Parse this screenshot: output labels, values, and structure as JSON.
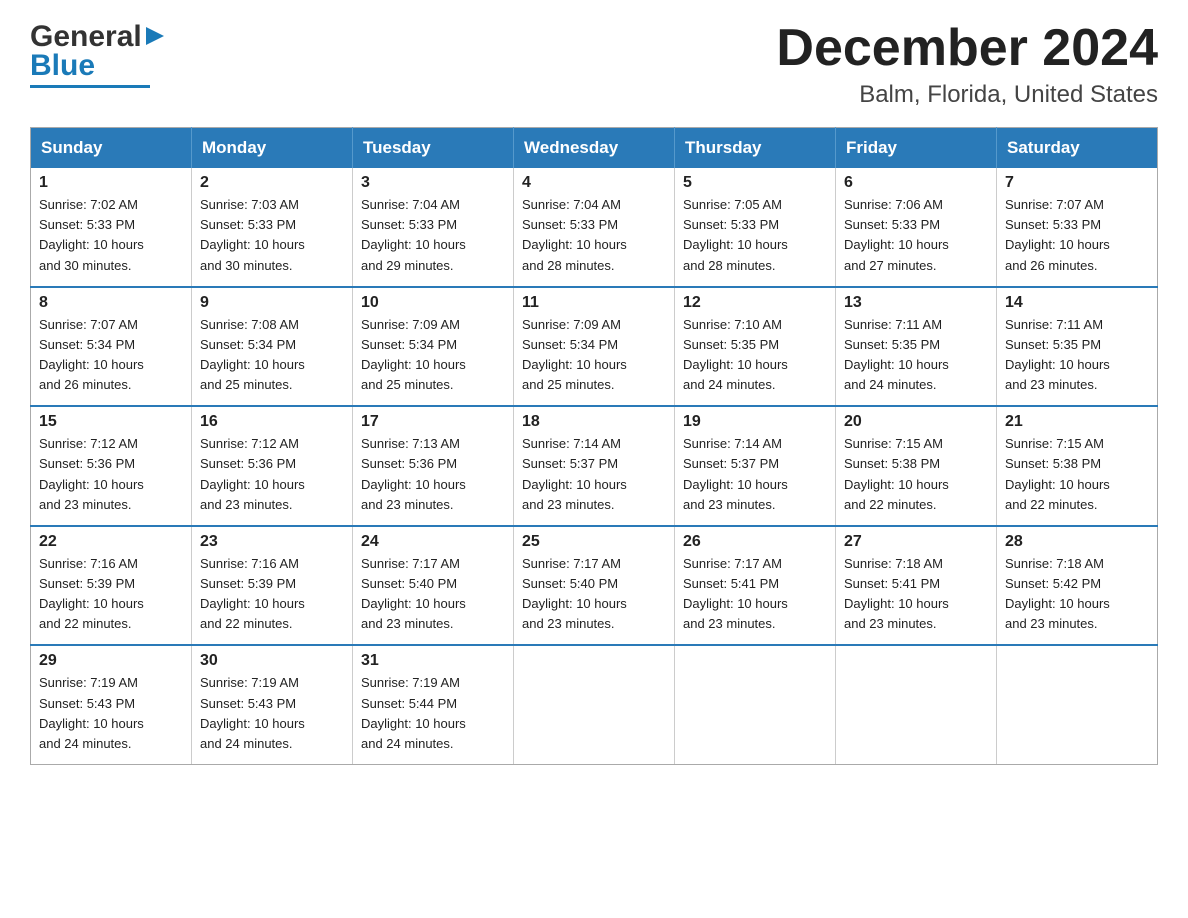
{
  "logo": {
    "text_general": "General",
    "text_blue": "Blue",
    "triangle": "▶"
  },
  "title": {
    "month": "December 2024",
    "location": "Balm, Florida, United States"
  },
  "headers": [
    "Sunday",
    "Monday",
    "Tuesday",
    "Wednesday",
    "Thursday",
    "Friday",
    "Saturday"
  ],
  "weeks": [
    [
      {
        "day": "1",
        "sunrise": "7:02 AM",
        "sunset": "5:33 PM",
        "daylight": "10 hours and 30 minutes."
      },
      {
        "day": "2",
        "sunrise": "7:03 AM",
        "sunset": "5:33 PM",
        "daylight": "10 hours and 30 minutes."
      },
      {
        "day": "3",
        "sunrise": "7:04 AM",
        "sunset": "5:33 PM",
        "daylight": "10 hours and 29 minutes."
      },
      {
        "day": "4",
        "sunrise": "7:04 AM",
        "sunset": "5:33 PM",
        "daylight": "10 hours and 28 minutes."
      },
      {
        "day": "5",
        "sunrise": "7:05 AM",
        "sunset": "5:33 PM",
        "daylight": "10 hours and 28 minutes."
      },
      {
        "day": "6",
        "sunrise": "7:06 AM",
        "sunset": "5:33 PM",
        "daylight": "10 hours and 27 minutes."
      },
      {
        "day": "7",
        "sunrise": "7:07 AM",
        "sunset": "5:33 PM",
        "daylight": "10 hours and 26 minutes."
      }
    ],
    [
      {
        "day": "8",
        "sunrise": "7:07 AM",
        "sunset": "5:34 PM",
        "daylight": "10 hours and 26 minutes."
      },
      {
        "day": "9",
        "sunrise": "7:08 AM",
        "sunset": "5:34 PM",
        "daylight": "10 hours and 25 minutes."
      },
      {
        "day": "10",
        "sunrise": "7:09 AM",
        "sunset": "5:34 PM",
        "daylight": "10 hours and 25 minutes."
      },
      {
        "day": "11",
        "sunrise": "7:09 AM",
        "sunset": "5:34 PM",
        "daylight": "10 hours and 25 minutes."
      },
      {
        "day": "12",
        "sunrise": "7:10 AM",
        "sunset": "5:35 PM",
        "daylight": "10 hours and 24 minutes."
      },
      {
        "day": "13",
        "sunrise": "7:11 AM",
        "sunset": "5:35 PM",
        "daylight": "10 hours and 24 minutes."
      },
      {
        "day": "14",
        "sunrise": "7:11 AM",
        "sunset": "5:35 PM",
        "daylight": "10 hours and 23 minutes."
      }
    ],
    [
      {
        "day": "15",
        "sunrise": "7:12 AM",
        "sunset": "5:36 PM",
        "daylight": "10 hours and 23 minutes."
      },
      {
        "day": "16",
        "sunrise": "7:12 AM",
        "sunset": "5:36 PM",
        "daylight": "10 hours and 23 minutes."
      },
      {
        "day": "17",
        "sunrise": "7:13 AM",
        "sunset": "5:36 PM",
        "daylight": "10 hours and 23 minutes."
      },
      {
        "day": "18",
        "sunrise": "7:14 AM",
        "sunset": "5:37 PM",
        "daylight": "10 hours and 23 minutes."
      },
      {
        "day": "19",
        "sunrise": "7:14 AM",
        "sunset": "5:37 PM",
        "daylight": "10 hours and 23 minutes."
      },
      {
        "day": "20",
        "sunrise": "7:15 AM",
        "sunset": "5:38 PM",
        "daylight": "10 hours and 22 minutes."
      },
      {
        "day": "21",
        "sunrise": "7:15 AM",
        "sunset": "5:38 PM",
        "daylight": "10 hours and 22 minutes."
      }
    ],
    [
      {
        "day": "22",
        "sunrise": "7:16 AM",
        "sunset": "5:39 PM",
        "daylight": "10 hours and 22 minutes."
      },
      {
        "day": "23",
        "sunrise": "7:16 AM",
        "sunset": "5:39 PM",
        "daylight": "10 hours and 22 minutes."
      },
      {
        "day": "24",
        "sunrise": "7:17 AM",
        "sunset": "5:40 PM",
        "daylight": "10 hours and 23 minutes."
      },
      {
        "day": "25",
        "sunrise": "7:17 AM",
        "sunset": "5:40 PM",
        "daylight": "10 hours and 23 minutes."
      },
      {
        "day": "26",
        "sunrise": "7:17 AM",
        "sunset": "5:41 PM",
        "daylight": "10 hours and 23 minutes."
      },
      {
        "day": "27",
        "sunrise": "7:18 AM",
        "sunset": "5:41 PM",
        "daylight": "10 hours and 23 minutes."
      },
      {
        "day": "28",
        "sunrise": "7:18 AM",
        "sunset": "5:42 PM",
        "daylight": "10 hours and 23 minutes."
      }
    ],
    [
      {
        "day": "29",
        "sunrise": "7:19 AM",
        "sunset": "5:43 PM",
        "daylight": "10 hours and 24 minutes."
      },
      {
        "day": "30",
        "sunrise": "7:19 AM",
        "sunset": "5:43 PM",
        "daylight": "10 hours and 24 minutes."
      },
      {
        "day": "31",
        "sunrise": "7:19 AM",
        "sunset": "5:44 PM",
        "daylight": "10 hours and 24 minutes."
      },
      null,
      null,
      null,
      null
    ]
  ],
  "labels": {
    "sunrise": "Sunrise:",
    "sunset": "Sunset:",
    "daylight": "Daylight:"
  }
}
